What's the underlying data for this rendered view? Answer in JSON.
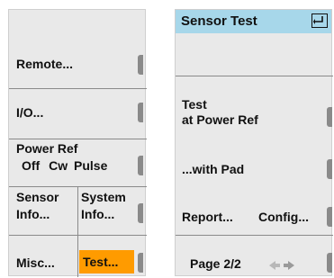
{
  "left_panel": {
    "remote": "Remote...",
    "io": "I/O...",
    "power_ref": {
      "title": "Power Ref",
      "off": "Off",
      "cw": "Cw",
      "pulse": "Pulse"
    },
    "sensor_info": {
      "line1": "Sensor",
      "line2": "Info..."
    },
    "system_info": {
      "line1": "System",
      "line2": "Info..."
    },
    "misc": "Misc...",
    "test": "Test..."
  },
  "right_panel": {
    "header": {
      "title": "Sensor Test"
    },
    "test_power_ref": {
      "line1": "Test",
      "line2": "at Power Ref"
    },
    "with_pad": "...with Pad",
    "report": "Report...",
    "config": "Config...",
    "page": "Page 2/2"
  },
  "colors": {
    "header_bg": "#a7d7ea",
    "highlight": "#ff9b00",
    "panel_bg": "#e9e9e9",
    "divider": "#8a8a8a"
  },
  "icons": {
    "enter": "enter-return-icon",
    "nav": "left-right-arrows-icon",
    "softkey_tab": "softkey-tab-icon"
  }
}
